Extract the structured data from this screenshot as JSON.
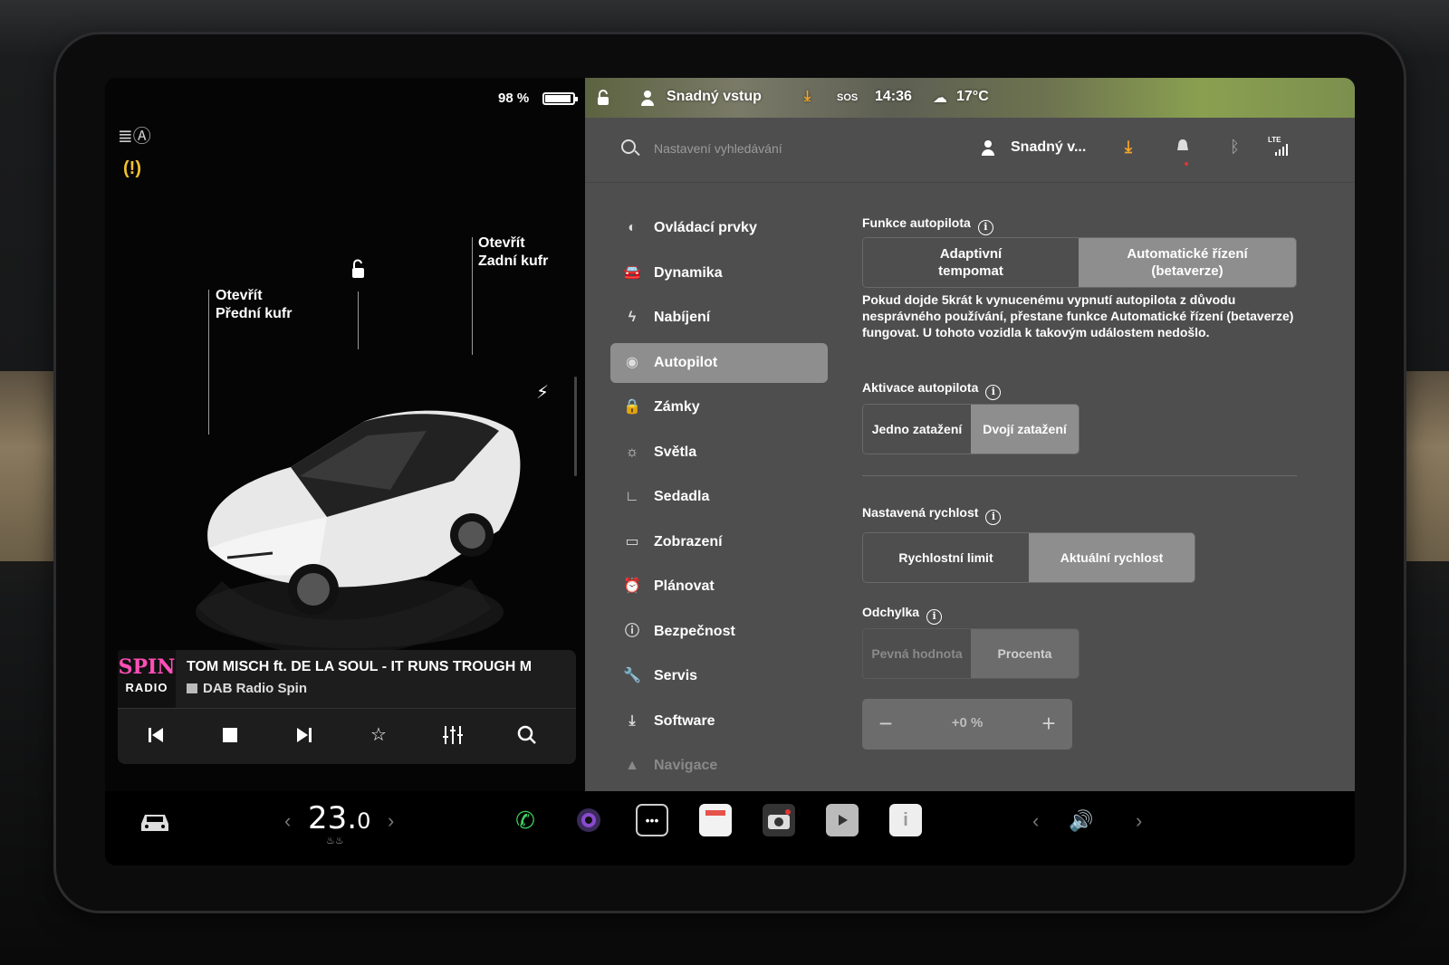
{
  "left": {
    "battery_pct": "98 %",
    "callout_front": [
      "Otevřít",
      "Přední kufr"
    ],
    "callout_rear": [
      "Otevřít",
      "Zadní kufr"
    ]
  },
  "media": {
    "logo_top": "SPIN",
    "logo_bottom": "RADIO",
    "title": "TOM MISCH ft. DE LA SOUL - IT RUNS TROUGH M",
    "source": "DAB Radio Spin",
    "controls": [
      "previous-icon",
      "stop-icon",
      "next-icon",
      "favorite-star-icon",
      "equalizer-icon",
      "search-icon"
    ]
  },
  "status": {
    "profile": "Snadný vstup",
    "sos": "SOS",
    "time": "14:36",
    "temperature": "17°C"
  },
  "search": {
    "placeholder": "Nastavení vyhledávání",
    "profile_short": "Snadný v...",
    "lte": "LTE"
  },
  "nav": {
    "items": [
      {
        "label": "Ovládací prvky",
        "icon": "toggle-icon"
      },
      {
        "label": "Dynamika",
        "icon": "car-icon"
      },
      {
        "label": "Nabíjení",
        "icon": "bolt-icon"
      },
      {
        "label": "Autopilot",
        "icon": "steering-wheel-icon"
      },
      {
        "label": "Zámky",
        "icon": "lock-icon"
      },
      {
        "label": "Světla",
        "icon": "sun-icon"
      },
      {
        "label": "Sedadla",
        "icon": "seat-icon"
      },
      {
        "label": "Zobrazení",
        "icon": "display-icon"
      },
      {
        "label": "Plánovat",
        "icon": "alarm-clock-icon"
      },
      {
        "label": "Bezpečnost",
        "icon": "alert-circle-icon"
      },
      {
        "label": "Servis",
        "icon": "wrench-icon"
      },
      {
        "label": "Software",
        "icon": "download-icon"
      },
      {
        "label": "Navigace",
        "icon": "navigation-arrow-icon"
      }
    ],
    "active_index": 3
  },
  "autopilot": {
    "features": {
      "title": "Funkce autopilota",
      "options": [
        "Adaptivní\ntempomat",
        "Automatické řízení\n(betaverze)"
      ],
      "selected": 1
    },
    "warning": "Pokud dojde 5krát k vynucenému vypnutí autopilota z důvodu nesprávného používání, přestane funkce Automatické řízení (betaverze) fungovat. U tohoto vozidla k takovým událostem nedošlo.",
    "activation": {
      "title": "Aktivace autopilota",
      "options": [
        "Jedno zatažení",
        "Dvojí zatažení"
      ],
      "selected": 1
    },
    "set_speed": {
      "title": "Nastavená rychlost",
      "options": [
        "Rychlostní limit",
        "Aktuální rychlost"
      ],
      "selected": 1
    },
    "offset": {
      "title": "Odchylka",
      "options": [
        "Pevná hodnota",
        "Procenta"
      ],
      "selected": 1,
      "value": "+0 %",
      "minus": "−",
      "plus": "+"
    }
  },
  "bottom": {
    "temperature_whole": "23.",
    "temperature_decimal": "0",
    "apps": [
      "phone-icon",
      "camera-lens-icon",
      "more-icon",
      "calendar-icon",
      "dashcam-icon",
      "video-icon",
      "manual-icon"
    ]
  },
  "colors": {
    "panel": "#4f4e4f",
    "selected": "#8f8e8f",
    "accent_orange": "#f5a623",
    "spin_pink": "#ff4fb8",
    "phone_green": "#3ecf5e"
  }
}
